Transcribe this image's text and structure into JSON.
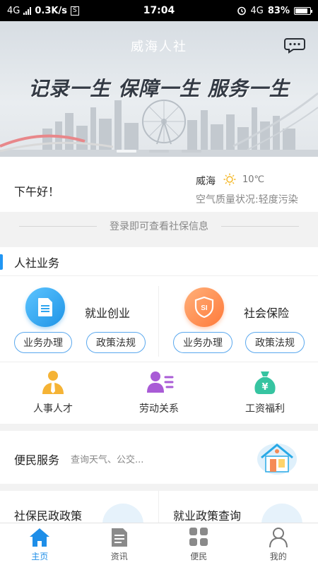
{
  "status_bar": {
    "network": "4G",
    "speed": "0.3K/s",
    "sim_badge": "S",
    "time": "17:04",
    "network_right": "4G",
    "battery": "83%",
    "battery_level": 0.83
  },
  "banner": {
    "title": "威海人社",
    "slogan": "记录一生 保障一生 服务一生",
    "message_icon": "chat-bubble-icon",
    "slides_total": 3,
    "active_slide": 1
  },
  "greeting": {
    "hello": "下午好！",
    "city": "威海",
    "weather_icon": "sun-icon",
    "temperature": "10℃",
    "air_quality": "空气质量状况:轻度污染"
  },
  "login_hint": "登录即可查看社保信息",
  "hr_services": {
    "title": "人社业务",
    "accent": "#2196f3",
    "big_items": [
      {
        "name": "就业创业",
        "icon": "document-icon",
        "color": "#2fa5ef",
        "actions": [
          "业务办理",
          "政策法规"
        ]
      },
      {
        "name": "社会保险",
        "icon": "si-shield-icon",
        "color": "#ff8a4a",
        "actions": [
          "业务办理",
          "政策法规"
        ]
      }
    ],
    "small_items": [
      {
        "name": "人事人才",
        "icon": "person-tie-icon"
      },
      {
        "name": "劳动关系",
        "icon": "person-list-icon"
      },
      {
        "name": "工资福利",
        "icon": "money-bag-icon"
      }
    ]
  },
  "convenience": {
    "title": "便民服务",
    "subtitle": "查询天气、公交...",
    "icon": "house-icon"
  },
  "policy": [
    {
      "name": "社保民政政策"
    },
    {
      "name": "就业政策查询"
    }
  ],
  "tabbar": {
    "items": [
      {
        "label": "主页",
        "icon": "home-icon",
        "active": true
      },
      {
        "label": "资讯",
        "icon": "news-icon",
        "active": false
      },
      {
        "label": "便民",
        "icon": "grid-icon",
        "active": false
      },
      {
        "label": "我的",
        "icon": "user-icon",
        "active": false
      }
    ],
    "active_color": "#1e8ee8"
  }
}
